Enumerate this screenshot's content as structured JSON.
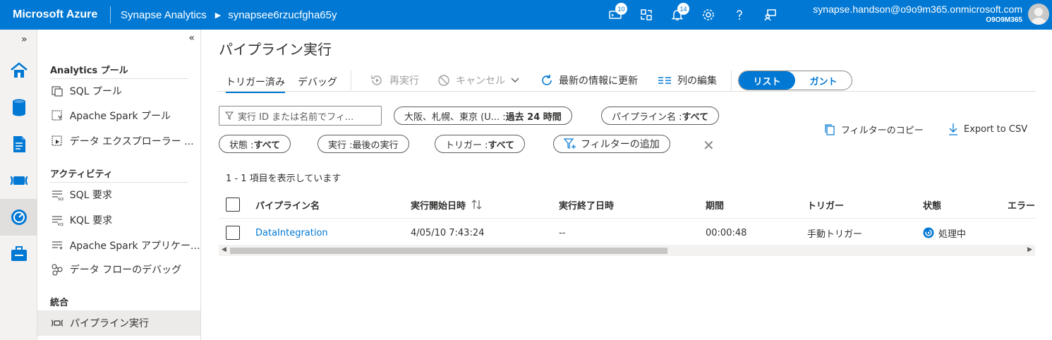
{
  "topbar": {
    "brand": "Microsoft Azure",
    "service": "Synapse Analytics",
    "workspace": "synapsee6rzucfgha65y",
    "icons": [
      {
        "name": "cloud-shell-icon",
        "badge": "10"
      },
      {
        "name": "directory-switch-icon",
        "badge": ""
      },
      {
        "name": "notifications-icon",
        "badge": "14"
      },
      {
        "name": "settings-icon",
        "badge": ""
      },
      {
        "name": "help-icon",
        "badge": ""
      },
      {
        "name": "feedback-icon",
        "badge": ""
      }
    ],
    "user_email": "synapse.handson@o9o9m365.onmicrosoft.com",
    "user_tenant": "O9O9M365"
  },
  "rail": {
    "expand": "»",
    "items": [
      {
        "name": "home-icon"
      },
      {
        "name": "data-icon"
      },
      {
        "name": "develop-icon"
      },
      {
        "name": "integrate-icon"
      },
      {
        "name": "monitor-icon",
        "active": true
      },
      {
        "name": "manage-icon"
      }
    ]
  },
  "nav": {
    "collapse": "«",
    "sections": [
      {
        "title": "Analytics プール",
        "items": [
          "SQL プール",
          "Apache Spark プール",
          "データ エクスプローラー ..."
        ]
      },
      {
        "title": "アクティビティ",
        "items": [
          "SQL 要求",
          "KQL 要求",
          "Apache Spark アプリケーシ...",
          "データ フローのデバッグ"
        ]
      },
      {
        "title": "統合",
        "items": [
          "パイプライン実行"
        ]
      }
    ]
  },
  "main": {
    "title": "パイプライン実行",
    "tabs": [
      "トリガー済み",
      "デバッグ"
    ],
    "commands": {
      "rerun": "再実行",
      "cancel": "キャンセル",
      "refresh": "最新の情報に更新",
      "edit_columns": "列の編集"
    },
    "view_toggle": {
      "list": "リスト",
      "gantt": "ガント"
    },
    "search_placeholder": "実行 ID または名前でフィ...",
    "filters": {
      "time_prefix": "大阪、札幌、東京 (U... : ",
      "time_value": "過去 24 時間",
      "pipeline_prefix": "パイプライン名 : ",
      "pipeline_value": "すべて",
      "status_prefix": "状態 : ",
      "status_value": "すべて",
      "run_prefix": "実行 : ",
      "run_value": "最後の実行",
      "trigger_prefix": "トリガー : ",
      "trigger_value": "すべて",
      "add_filter": "フィルターの追加"
    },
    "copy_filters": "フィルターのコピー",
    "export_csv": "Export to CSV",
    "count_text": "1 - 1 項目を表示しています",
    "columns": [
      "パイプライン名",
      "実行開始日時",
      "実行終了日時",
      "期間",
      "トリガー",
      "状態",
      "エラー"
    ],
    "rows": [
      {
        "pipeline": "DataIntegration",
        "start": "4/05/10 7:43:24",
        "end": "--",
        "duration": "00:00:48",
        "trigger": "手動トリガー",
        "status": "処理中"
      }
    ]
  },
  "colors": {
    "accent": "#0078d4",
    "rail_bg": "#f3f2f1",
    "border": "#e1dfdd"
  }
}
